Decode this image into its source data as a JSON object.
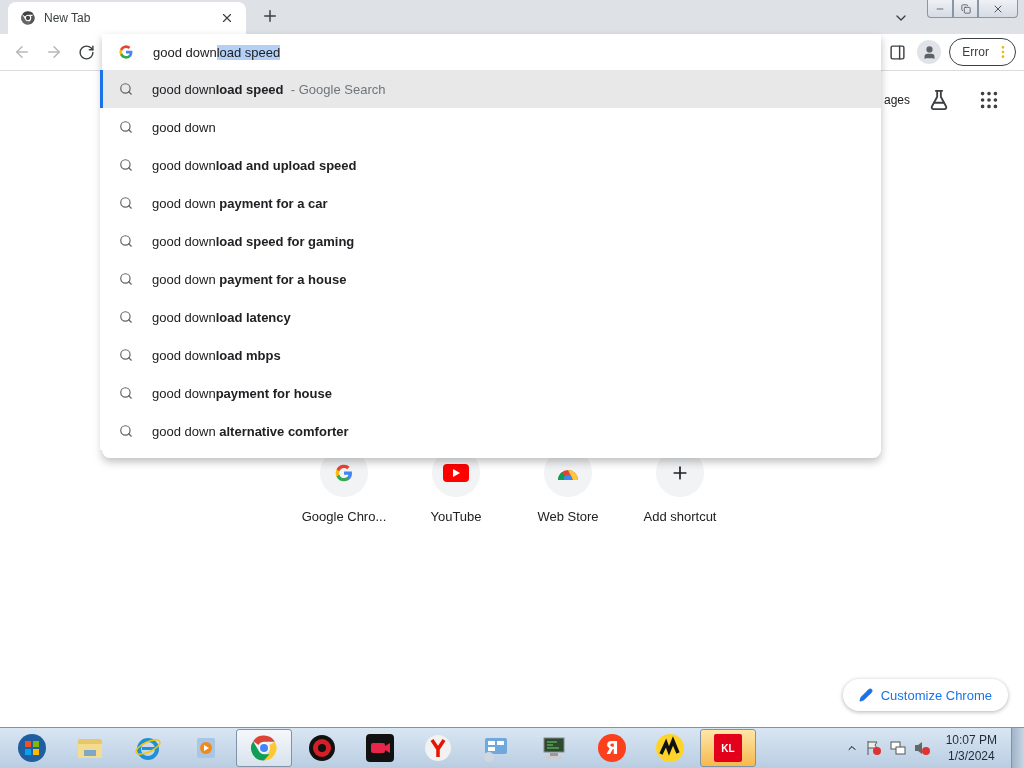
{
  "tabs": [
    {
      "title": "New Tab",
      "selected": true
    }
  ],
  "omnibox": {
    "typed": "good down",
    "autocompleted": "load speed"
  },
  "suggestions": [
    {
      "text": "good down**load speed**",
      "suffix": "- Google Search",
      "selected": true
    },
    {
      "text": "good down",
      "selected": false
    },
    {
      "text": "good down**load and upload speed**",
      "selected": false
    },
    {
      "text": "good down **payment for a car**",
      "selected": false
    },
    {
      "text": "good down**load speed for gaming**",
      "selected": false
    },
    {
      "text": "good down **payment for a house**",
      "selected": false
    },
    {
      "text": "good down**load latency**",
      "selected": false
    },
    {
      "text": "good down**load mbps**",
      "selected": false
    },
    {
      "text": "good down**payment for house**",
      "selected": false
    },
    {
      "text": "good down **alternative comforter**",
      "selected": false
    }
  ],
  "profile": {
    "status": "Error"
  },
  "header_link": "ages",
  "shortcuts": [
    {
      "kind": "google",
      "label": "Google Chro..."
    },
    {
      "kind": "youtube",
      "label": "YouTube"
    },
    {
      "kind": "webstore",
      "label": "Web Store"
    },
    {
      "kind": "add",
      "label": "Add shortcut"
    }
  ],
  "customize_button": "Customize Chrome",
  "taskbar": {
    "items": [
      {
        "kind": "start",
        "active": false
      },
      {
        "kind": "explorer",
        "active": false
      },
      {
        "kind": "ie",
        "active": false
      },
      {
        "kind": "media",
        "active": false
      },
      {
        "kind": "chrome",
        "active": true
      },
      {
        "kind": "gamebooster",
        "active": false
      },
      {
        "kind": "recorder",
        "active": false
      },
      {
        "kind": "yandexbrowser",
        "active": false
      },
      {
        "kind": "panel",
        "active": false
      },
      {
        "kind": "monitor",
        "active": false
      },
      {
        "kind": "yandex",
        "glyph": "Я",
        "active": false
      },
      {
        "kind": "market",
        "active": false
      },
      {
        "kind": "kl",
        "glyph": "KL",
        "active": true
      }
    ],
    "time": "10:07 PM",
    "date": "1/3/2024"
  }
}
